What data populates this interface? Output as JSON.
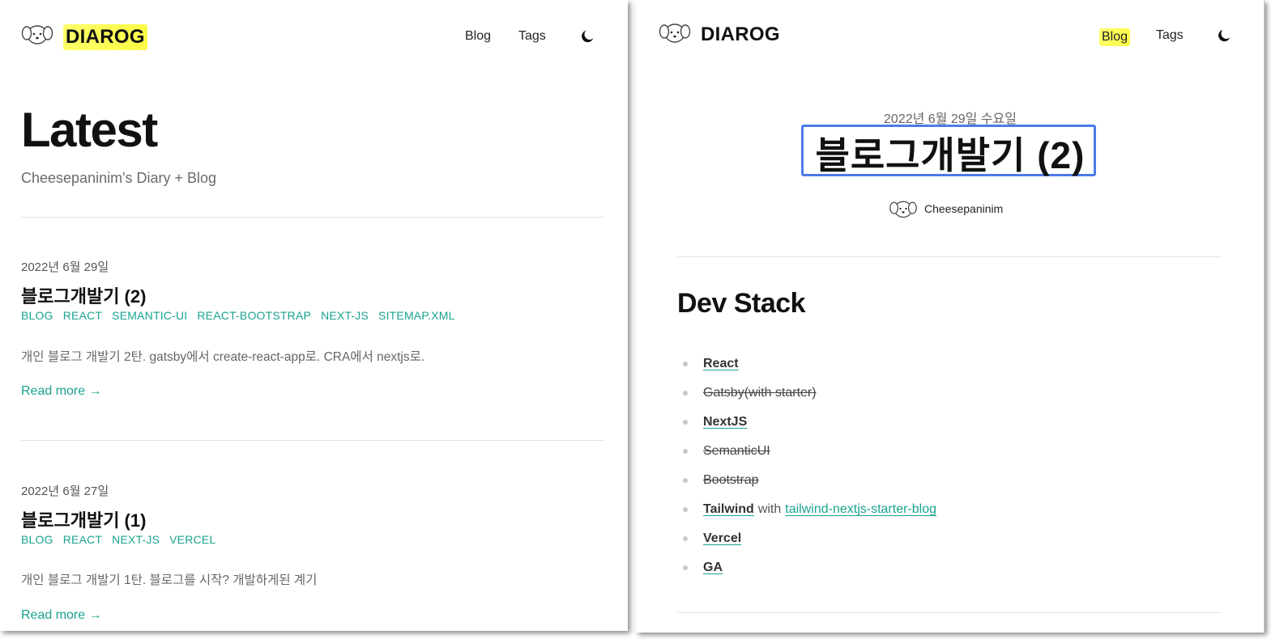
{
  "left": {
    "brand": "DIAROG",
    "nav": {
      "blog": "Blog",
      "tags": "Tags"
    },
    "title": "Latest",
    "subtitle": "Cheesepaninim's Diary + Blog",
    "posts": [
      {
        "date": "2022년 6월 29일",
        "title": "블로그개발기 (2)",
        "tags": [
          "BLOG",
          "REACT",
          "SEMANTIC-UI",
          "REACT-BOOTSTRAP",
          "NEXT-JS",
          "SITEMAP.XML"
        ],
        "desc": "개인 블로그 개발기 2탄. gatsby에서 create-react-app로. CRA에서 nextjs로.",
        "read_more": "Read more →"
      },
      {
        "date": "2022년 6월 27일",
        "title": "블로그개발기 (1)",
        "tags": [
          "BLOG",
          "REACT",
          "NEXT-JS",
          "VERCEL"
        ],
        "desc": "개인 블로그 개발기 1탄. 블로그를 시작? 개발하게된 계기",
        "read_more": "Read more →"
      }
    ]
  },
  "right": {
    "brand": "DIAROG",
    "nav": {
      "blog": "Blog",
      "tags": "Tags"
    },
    "date": "2022년 6월 29일 수요일",
    "title": "블로그개발기 (2)",
    "author": "Cheesepaninim",
    "section": "Dev Stack",
    "stack": {
      "react": "React",
      "gatsby": "Gatsby(with starter)",
      "nextjs": "NextJS",
      "semantic": "SemanticUI",
      "bootstrap": "Bootstrap",
      "tailwind": "Tailwind",
      "with": "with",
      "starter": "tailwind-nextjs-starter-blog",
      "vercel": "Vercel",
      "ga": "GA"
    }
  },
  "colors": {
    "accent": "#1aa38f",
    "highlight": "#fafa50",
    "focus_box": "#4b7be8"
  },
  "icons": [
    "dog-logo-icon",
    "moon-icon",
    "author-avatar-icon"
  ]
}
